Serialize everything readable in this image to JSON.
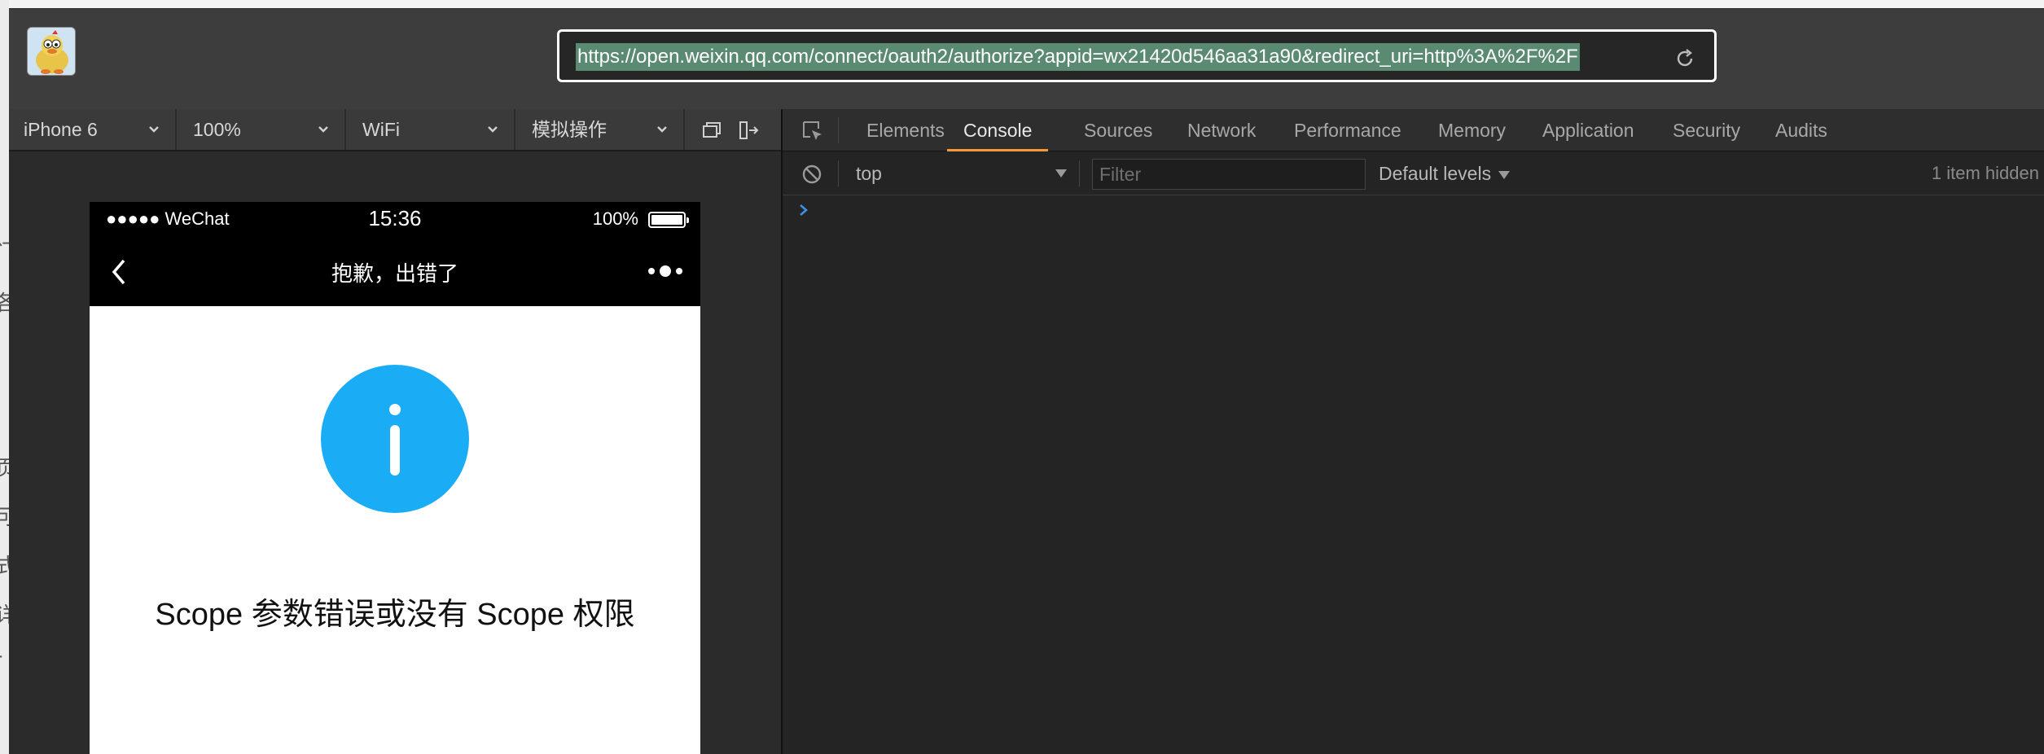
{
  "address_bar": {
    "url": "https://open.weixin.qq.com/connect/oauth2/authorize?appid=wx21420d546aa31a90&redirect_uri=http%3A%2F%2F"
  },
  "simulator_toolbar": {
    "device": "iPhone 6",
    "zoom": "100%",
    "network": "WiFi",
    "action": "模拟操作"
  },
  "phone": {
    "status_bar": {
      "carrier": "●●●●● WeChat",
      "time": "15:36",
      "battery": "100%"
    },
    "nav_title": "抱歉，出错了",
    "message": "Scope 参数错误或没有 Scope 权限",
    "info_color": "#1aadf5"
  },
  "devtools": {
    "tabs": [
      "Elements",
      "Console",
      "Sources",
      "Network",
      "Performance",
      "Memory",
      "Application",
      "Security",
      "Audits"
    ],
    "active_tab": "Console",
    "console": {
      "context": "top",
      "filter_placeholder": "Filter",
      "levels": "Default levels",
      "hidden_count": "1 item hidden"
    }
  },
  "colors": {
    "accent_tab": "#f29a3b",
    "url_selection": "#5b8a73"
  }
}
